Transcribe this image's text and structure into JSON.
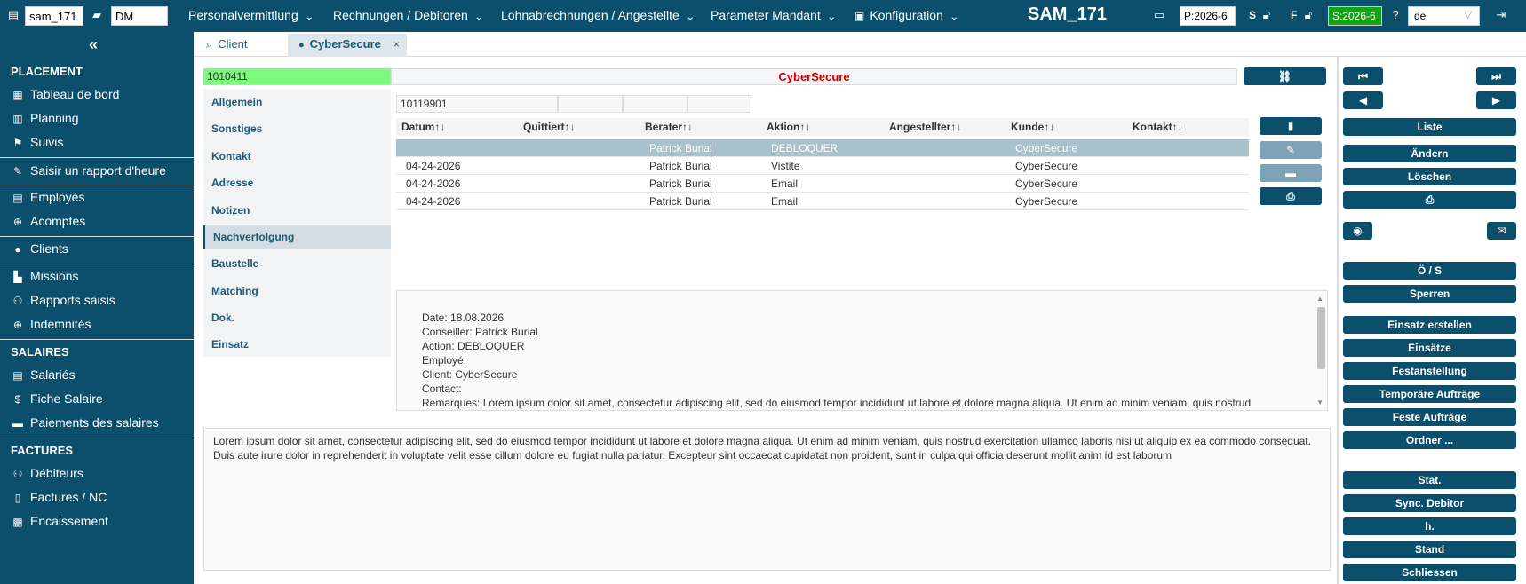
{
  "topbar": {
    "user_input": "sam_171",
    "folder_input": "DM",
    "menus": [
      {
        "label": "Personalvermittlung"
      },
      {
        "label": "Rechnungen / Debitoren"
      },
      {
        "label": "Lohnabrechnungen / Angestellte"
      },
      {
        "label": "Parameter Mandant"
      },
      {
        "label": "Konfiguration"
      }
    ],
    "brand": "SAM_171",
    "period_p": "P:2026-6",
    "letter_s": "S",
    "letter_f": "F",
    "period_s": "S:2026-6",
    "period_s_color": "#15a215",
    "language": "de"
  },
  "sidebar": {
    "sections": [
      {
        "title": "PLACEMENT",
        "items": [
          {
            "label": "Tableau de bord",
            "icon": "table-icon"
          },
          {
            "label": "Planning",
            "icon": "calendar-icon"
          },
          {
            "label": "Suivis",
            "icon": "flag-icon"
          }
        ]
      },
      {
        "title": "",
        "items": [
          {
            "label": "Saisir un rapport d'heure",
            "icon": "pencil-icon"
          },
          {
            "label": "Employés",
            "icon": "id-card-icon"
          },
          {
            "label": "Acomptes",
            "icon": "hand-coin-icon"
          }
        ]
      },
      {
        "title": "",
        "items": [
          {
            "label": "Clients",
            "icon": "user-icon"
          },
          {
            "label": "Missions",
            "icon": "building-icon"
          },
          {
            "label": "Rapports saisis",
            "icon": "users-icon"
          },
          {
            "label": "Indemnités",
            "icon": "hand-coin-icon"
          }
        ]
      },
      {
        "title": "SALAIRES",
        "items": [
          {
            "label": "Salariés",
            "icon": "id-card-icon"
          },
          {
            "label": "Fiche Salaire",
            "icon": "dollar-icon"
          },
          {
            "label": "Paiements des salaires",
            "icon": "wallet-icon"
          }
        ]
      },
      {
        "title": "FACTURES",
        "items": [
          {
            "label": "Débiteurs",
            "icon": "users-icon"
          },
          {
            "label": "Factures / NC",
            "icon": "file-icon"
          },
          {
            "label": "Encaissement",
            "icon": "cash-register-icon"
          }
        ]
      }
    ]
  },
  "tabs": [
    {
      "label": "Client",
      "icon": "search-icon"
    },
    {
      "label": "CyberSecure",
      "icon": "user-icon",
      "close": "×"
    }
  ],
  "record": {
    "id": "1010411",
    "name": "CyberSecure",
    "id_color": "#7dfa7d",
    "name_color": "#cc0000"
  },
  "subnav": [
    "Allgemein",
    "Sonstiges",
    "Kontakt",
    "Adresse",
    "Notizen",
    "Nachverfolgung",
    "Baustelle",
    "Matching",
    "Dok.",
    "Einsatz"
  ],
  "filter_value": "10119901",
  "table": {
    "headers": [
      "Datum",
      "Quittiert",
      "Berater",
      "Aktion",
      "Angestellter",
      "Kunde",
      "Kontakt"
    ],
    "sort_glyph": "↑↓",
    "rows": [
      {
        "datum": "",
        "quittiert": "",
        "berater": "Patrick Burial",
        "aktion": "DEBLOQUER",
        "angestellter": "",
        "kunde": "CyberSecure",
        "kontakt": ""
      },
      {
        "datum": "04-24-2026",
        "quittiert": "",
        "berater": "Patrick Burial",
        "aktion": "Vistite",
        "angestellter": "",
        "kunde": "CyberSecure",
        "kontakt": ""
      },
      {
        "datum": "04-24-2026",
        "quittiert": "",
        "berater": "Patrick Burial",
        "aktion": "Email",
        "angestellter": "",
        "kunde": "CyberSecure",
        "kontakt": ""
      },
      {
        "datum": "04-24-2026",
        "quittiert": "",
        "berater": "Patrick Burial",
        "aktion": "Email",
        "angestellter": "",
        "kunde": "CyberSecure",
        "kontakt": ""
      }
    ]
  },
  "detail": {
    "lines": [
      "Date: 18.08.2026",
      "Conseiller: Patrick Burial",
      "Action: DEBLOQUER",
      "Employé:",
      "Client: CyberSecure",
      "Contact:",
      "Remarques: Lorem ipsum dolor sit amet, consectetur adipiscing elit, sed do eiusmod tempor incididunt ut labore et dolore magna aliqua. Ut enim ad minim veniam, quis nostrud"
    ]
  },
  "notes": "Lorem ipsum dolor sit amet, consectetur adipiscing elit, sed do eiusmod tempor incididunt ut labore et dolore magna aliqua. Ut enim ad minim veniam, quis nostrud exercitation ullamco laboris nisi ut aliquip ex ea commodo consequat. Duis aute irure dolor in reprehenderit in voluptate velit esse cillum dolore eu fugiat nulla pariatur. Excepteur sint occaecat cupidatat non proident, sunt in culpa qui officia deserunt mollit anim id est laborum",
  "right_panel": {
    "buttons": [
      "Liste",
      "Ändern",
      "Löschen",
      "Ö / S",
      "Sperren",
      "Einsatz erstellen",
      "Einsätze",
      "Festanstellung",
      "Temporäre Aufträge",
      "Feste Aufträge",
      "Ordner ...",
      "Stat.",
      "Sync. Debitor",
      "h.",
      "Stand",
      "Schliessen"
    ]
  }
}
